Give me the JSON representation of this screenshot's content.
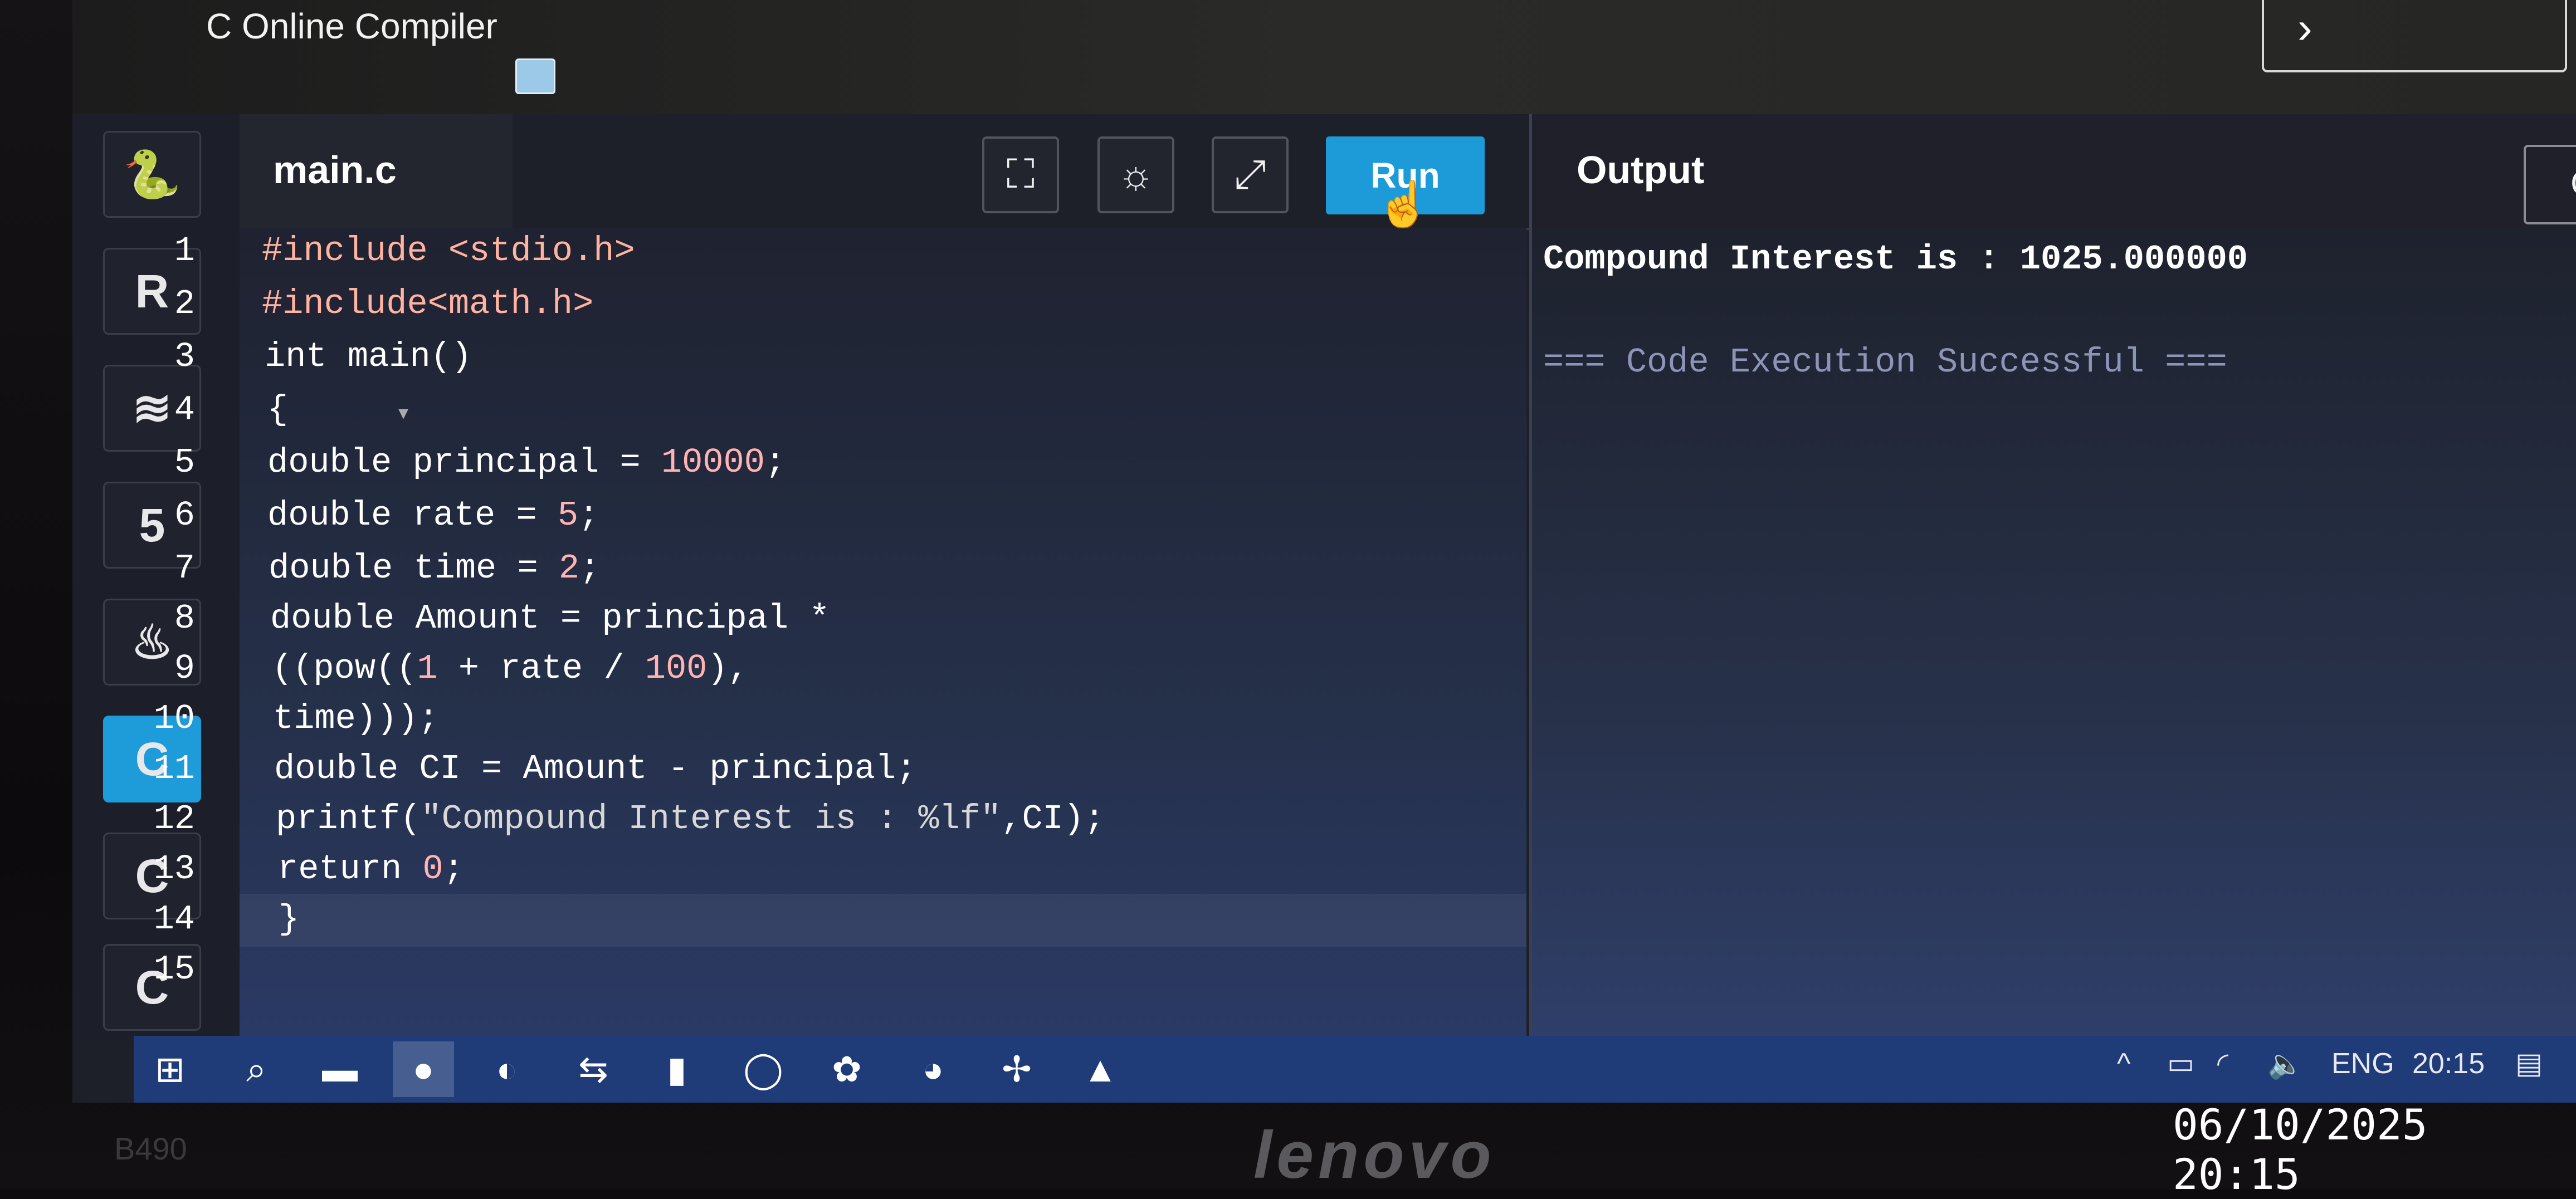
{
  "window": {
    "title": "C Online Compiler",
    "collapse_glyph": "›"
  },
  "sidebar": {
    "items": [
      {
        "name": "python",
        "glyph": "🐍"
      },
      {
        "name": "r",
        "glyph": "R"
      },
      {
        "name": "sql",
        "glyph": "≋"
      },
      {
        "name": "html",
        "glyph": "5"
      },
      {
        "name": "java",
        "glyph": "♨"
      },
      {
        "name": "c",
        "glyph": "C"
      },
      {
        "name": "cpp",
        "glyph": "C"
      },
      {
        "name": "csharp",
        "glyph": "C"
      }
    ],
    "active": "c"
  },
  "editor": {
    "tab_label": "main.c",
    "toolbar": {
      "fullscreen_glyph": "⛶",
      "theme_glyph": "☼",
      "share_glyph": "⤢",
      "run_label": "Run"
    },
    "line_numbers": [
      "1",
      "2",
      "3",
      "4",
      "5",
      "6",
      "7",
      "8",
      "9",
      "10",
      "11",
      "12",
      "13",
      "14",
      "15"
    ],
    "lines": [
      {
        "pp": "#include <stdio.h>"
      },
      {
        "pp": "#include<math.h>"
      },
      {
        "text": "int main()"
      },
      {
        "text": "{"
      },
      {
        "pre": "double principal = ",
        "num": "10000",
        "post": ";"
      },
      {
        "pre": "double rate = ",
        "num": "5",
        "post": ";"
      },
      {
        "pre": "double time = ",
        "num": "2",
        "post": ";"
      },
      {
        "text": "double Amount = principal *"
      },
      {
        "pre": "((pow((",
        "num": "1",
        "mid": " + rate / ",
        "num2": "100",
        "post": "),"
      },
      {
        "text": "time)));"
      },
      {
        "text": "double CI = Amount - principal;"
      },
      {
        "pre": "printf(",
        "str": "\"Compound Interest is : %lf\"",
        "post": ",CI);"
      },
      {
        "pre": "return ",
        "num": "0",
        "post": ";"
      },
      {
        "text": "}"
      },
      {
        "text": ""
      }
    ]
  },
  "output": {
    "title": "Output",
    "clear_label": "Clear",
    "lines": [
      "Compound Interest is : 1025.000000",
      "=== Code Execution Successful ==="
    ]
  },
  "taskbar": {
    "icons": [
      "windows-start",
      "search",
      "file-explorer",
      "firefox",
      "edge-beta",
      "teamviewer",
      "office-doc",
      "whatsapp",
      "chatgpt",
      "chrome-canary",
      "app-pinwheel",
      "acrobat"
    ],
    "lang": "ENG",
    "time": "20:15"
  },
  "device": {
    "model": "B490",
    "brand": "lenovo"
  },
  "photo_stamp": "06/10/2025 20:15",
  "colors": {
    "run": "#1c9bd8",
    "active_lang": "#1e9bd9",
    "taskbar": "#1f3b78"
  }
}
